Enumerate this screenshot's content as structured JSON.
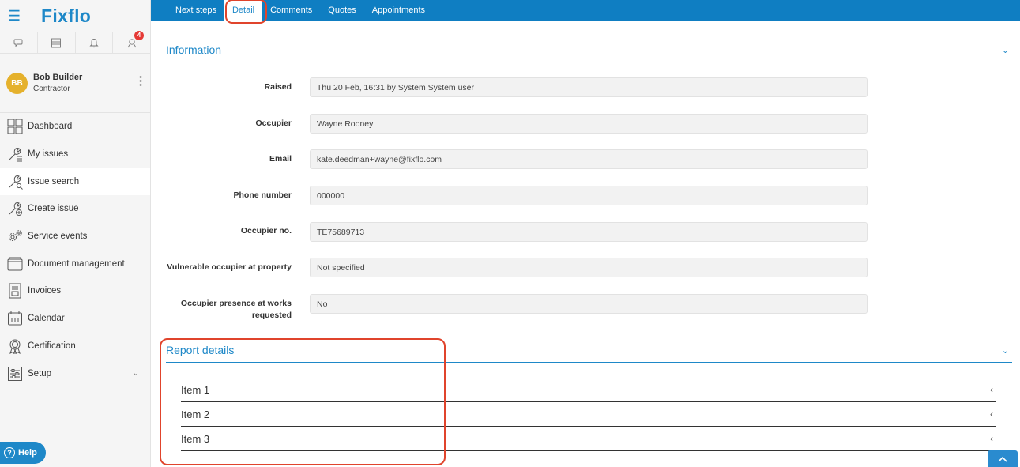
{
  "app": {
    "logo": "Fixflo"
  },
  "notifications": {
    "badge_count": "4"
  },
  "user": {
    "initials": "BB",
    "name": "Bob Builder",
    "role": "Contractor"
  },
  "sidebar": {
    "items": [
      {
        "label": "Dashboard"
      },
      {
        "label": "My issues"
      },
      {
        "label": "Issue search"
      },
      {
        "label": "Create issue"
      },
      {
        "label": "Service events"
      },
      {
        "label": "Document management"
      },
      {
        "label": "Invoices"
      },
      {
        "label": "Calendar"
      },
      {
        "label": "Certification"
      },
      {
        "label": "Setup"
      }
    ],
    "help_label": "Help"
  },
  "tabs": [
    {
      "label": "Next steps"
    },
    {
      "label": "Detail"
    },
    {
      "label": "Comments"
    },
    {
      "label": "Quotes"
    },
    {
      "label": "Appointments"
    }
  ],
  "information": {
    "title": "Information",
    "fields": [
      {
        "label": "Raised",
        "value": "Thu 20 Feb, 16:31 by System System user"
      },
      {
        "label": "Occupier",
        "value": "Wayne Rooney"
      },
      {
        "label": "Email",
        "value": "kate.deedman+wayne@fixflo.com"
      },
      {
        "label": "Phone number",
        "value": "000000"
      },
      {
        "label": "Occupier no.",
        "value": "TE75689713"
      },
      {
        "label": "Vulnerable occupier at property",
        "value": "Not specified"
      },
      {
        "label": "Occupier presence at works requested",
        "value": "No"
      }
    ]
  },
  "report": {
    "title": "Report details",
    "items": [
      {
        "label": "Item 1"
      },
      {
        "label": "Item 2"
      },
      {
        "label": "Item 3"
      }
    ]
  },
  "colors": {
    "brand": "#1e88c8",
    "topbar": "#0f7ec2",
    "highlight": "#e0442c",
    "avatar": "#e5b12c"
  }
}
